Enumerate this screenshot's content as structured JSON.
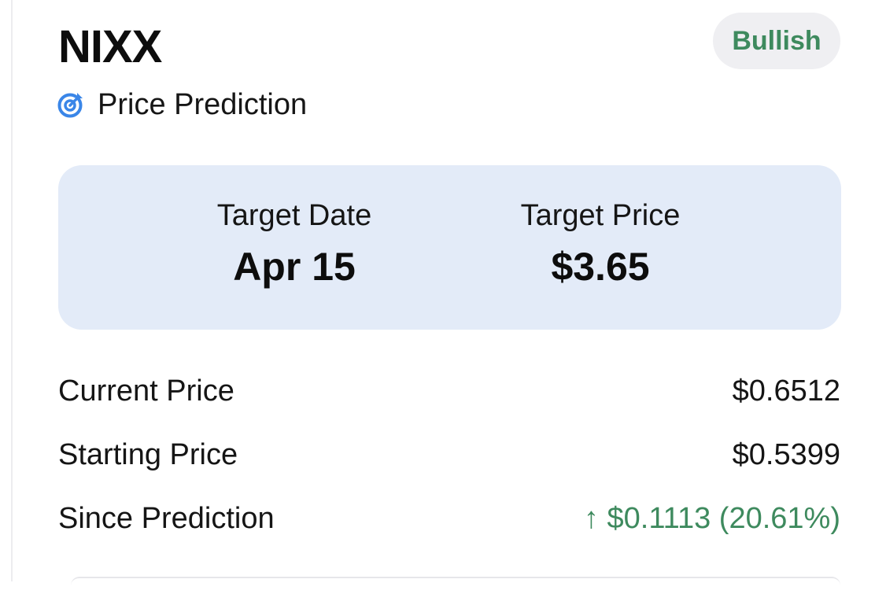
{
  "header": {
    "ticker": "NIXX",
    "sentiment_badge": "Bullish",
    "subtitle": "Price Prediction",
    "subtitle_icon": "target-icon"
  },
  "target": {
    "date_label": "Target Date",
    "date_value": "Apr 15",
    "price_label": "Target Price",
    "price_value": "$3.65"
  },
  "details": {
    "current_label": "Current Price",
    "current_value": "$0.6512",
    "starting_label": "Starting Price",
    "starting_value": "$0.5399",
    "since_label": "Since Prediction",
    "since_value": "↑ $0.1113 (20.61%)"
  },
  "colors": {
    "accent_green": "#3e8a5e",
    "target_box_bg": "#e3ebf8",
    "badge_bg": "#efeff2",
    "icon_blue": "#3a86e8"
  }
}
